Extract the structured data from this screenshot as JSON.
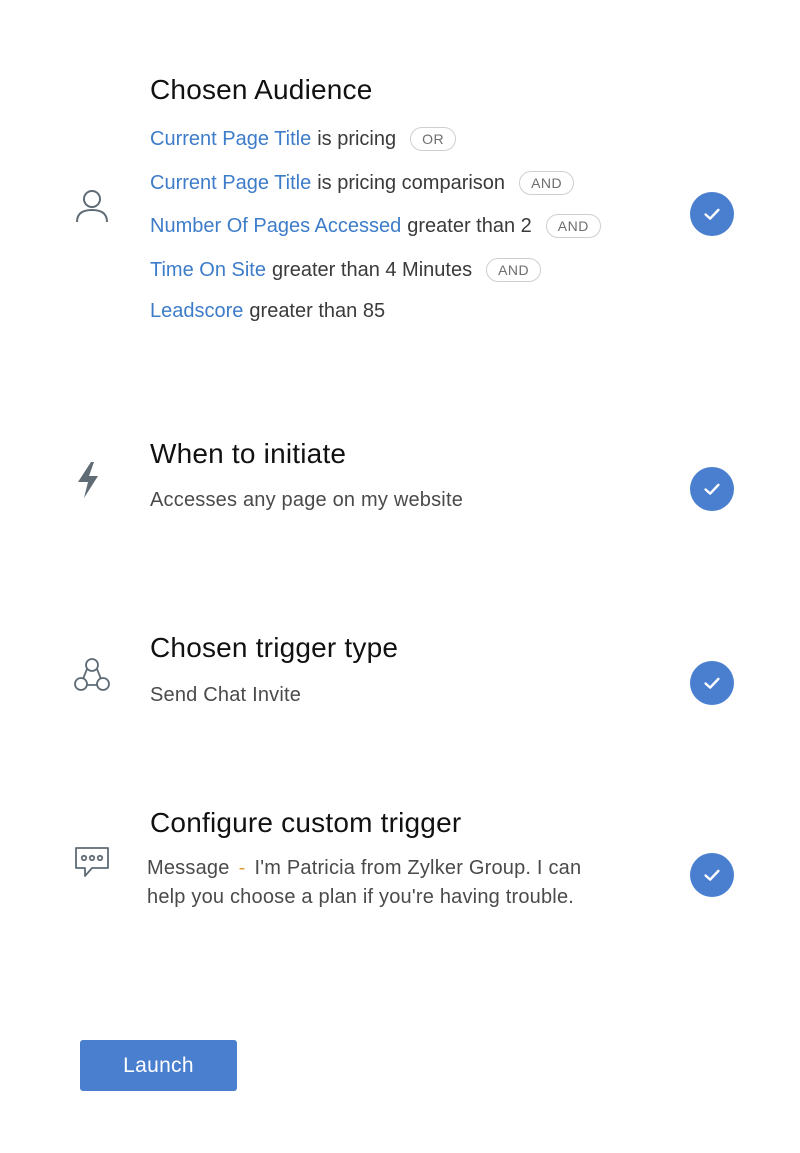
{
  "audience": {
    "title": "Chosen Audience",
    "icon": "user-icon",
    "conditions": [
      {
        "field": "Current Page Title",
        "rest": "is pricing",
        "connector": "OR"
      },
      {
        "field": "Current Page Title",
        "rest": "is pricing comparison",
        "connector": "AND"
      },
      {
        "field": "Number Of Pages Accessed",
        "rest": "greater than 2",
        "connector": "AND"
      },
      {
        "field": "Time On Site",
        "rest": "greater than 4 Minutes",
        "connector": "AND"
      },
      {
        "field": "Leadscore",
        "rest": "greater than 85",
        "connector": ""
      }
    ],
    "status": "completed"
  },
  "initiate": {
    "title": "When to initiate",
    "icon": "lightning-icon",
    "description": "Accesses any page on my website",
    "status": "completed"
  },
  "trigger_type": {
    "title": "Chosen trigger type",
    "icon": "network-icon",
    "description": "Send Chat Invite",
    "status": "completed"
  },
  "custom_trigger": {
    "title": "Configure custom trigger",
    "icon": "chat-bubble-icon",
    "message_label": "Message",
    "separator": "-",
    "message_text": "I'm Patricia from Zylker Group. I can help you choose a plan if you're having trouble.",
    "status": "completed"
  },
  "launch_label": "Launch",
  "colors": {
    "accent": "#4a7fd0",
    "field_link": "#3d7cc9",
    "separator": "#e39a3b"
  }
}
